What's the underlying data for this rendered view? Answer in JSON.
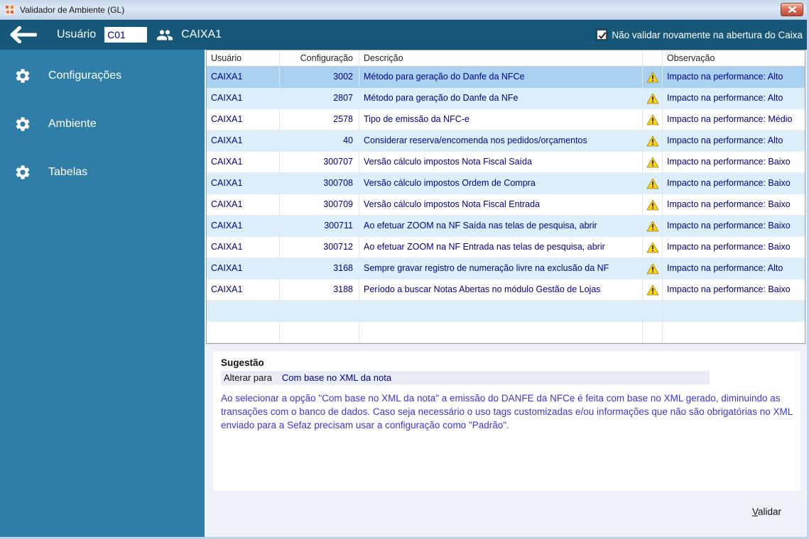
{
  "window": {
    "title": "Validador de Ambiente (GL)"
  },
  "header": {
    "user_label": "Usuário",
    "user_value": "C01",
    "user_name": "CAIXA1",
    "checkbox_label": "Não validar novamente na abertura do Caixa",
    "checkbox_checked": true
  },
  "sidebar": {
    "items": [
      {
        "label": "Configurações"
      },
      {
        "label": "Ambiente"
      },
      {
        "label": "Tabelas"
      }
    ]
  },
  "table": {
    "columns": [
      "Usuário",
      "Configuração",
      "Descrição",
      "Observação"
    ],
    "rows": [
      {
        "usuario": "CAIXA1",
        "config": "3002",
        "desc": "Método para geração do Danfe da NFCe",
        "obs": "Impacto na performance: Alto",
        "selected": true
      },
      {
        "usuario": "CAIXA1",
        "config": "2807",
        "desc": "Método para geração do Danfe da NFe",
        "obs": "Impacto na performance: Alto"
      },
      {
        "usuario": "CAIXA1",
        "config": "2578",
        "desc": "Tipo de emissão da NFC-e",
        "obs": "Impacto na performance: Médio"
      },
      {
        "usuario": "CAIXA1",
        "config": "40",
        "desc": "Considerar reserva/encomenda nos pedidos/orçamentos",
        "obs": "Impacto na performance: Alto"
      },
      {
        "usuario": "CAIXA1",
        "config": "300707",
        "desc": "Versão cálculo impostos Nota Fiscal Saída",
        "obs": "Impacto na performance: Baixo"
      },
      {
        "usuario": "CAIXA1",
        "config": "300708",
        "desc": "Versão cálculo impostos Ordem de Compra",
        "obs": "Impacto na performance: Baixo"
      },
      {
        "usuario": "CAIXA1",
        "config": "300709",
        "desc": "Versão cálculo impostos Nota Fiscal Entrada",
        "obs": "Impacto na performance: Baixo"
      },
      {
        "usuario": "CAIXA1",
        "config": "300711",
        "desc": "Ao efetuar ZOOM na NF Saída nas telas de pesquisa, abrir",
        "obs": "Impacto na performance: Baixo"
      },
      {
        "usuario": "CAIXA1",
        "config": "300712",
        "desc": "Ao efetuar ZOOM na NF Entrada nas telas de pesquisa, abrir",
        "obs": "Impacto na performance: Baixo"
      },
      {
        "usuario": "CAIXA1",
        "config": "3168",
        "desc": "Sempre gravar registro de numeração livre na exclusão da NF",
        "obs": "Impacto na performance: Alto"
      },
      {
        "usuario": "CAIXA1",
        "config": "3188",
        "desc": "Período a buscar Notas Abertas no módulo Gestão de Lojas",
        "obs": "Impacto na performance: Baixo"
      },
      {
        "usuario": "",
        "config": "",
        "desc": "",
        "obs": ""
      },
      {
        "usuario": "",
        "config": "",
        "desc": "",
        "obs": ""
      }
    ]
  },
  "suggestion": {
    "title": "Sugestão",
    "change_label": "Alterar para",
    "change_value": "Com base no XML da nota",
    "description": "Ao selecionar a opção \"Com base no XML da nota\" a emissão do DANFE da NFCe é feita com base no XML gerado, diminuindo as transações com o banco de dados. Caso seja necessário o uso tags customizadas e/ou informações que não são obrigatórias no XML enviado para a Sefaz precisam usar a configuração como \"Padrão\"."
  },
  "footer": {
    "validate_label": "Validar"
  },
  "icons": {
    "app": "app-logo",
    "close": "✕",
    "back": "←",
    "users": "👥",
    "gear": "⚙",
    "warning": "⚠",
    "check": "✓"
  },
  "colors": {
    "header_band": "#17587a",
    "sidebar": "#2f7ea8",
    "selected_row": "#a9d1f0",
    "alt_row": "#ddeefb",
    "table_text": "#00008b",
    "suggestion_text": "#3a36d8",
    "warning_yellow": "#ffd21e",
    "close_red": "#c04a35"
  }
}
